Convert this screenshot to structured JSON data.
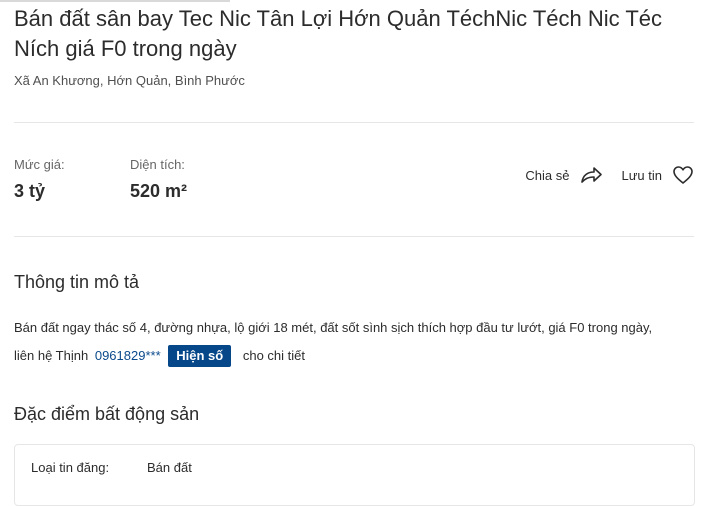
{
  "listing": {
    "title": "Bán đất sân bay Tec Nic Tân Lợi Hớn Quản TéchNic Téch Nic Téc Ních giá F0 trong ngày",
    "address": "Xã An Khương, Hớn Quản, Bình Phước"
  },
  "stats": {
    "price_label": "Mức giá:",
    "price_value": "3 tỷ",
    "area_label": "Diện tích:",
    "area_value": "520 m²"
  },
  "actions": {
    "share_label": "Chia sẻ",
    "share_icon": "share-arrow-icon",
    "save_label": "Lưu tin",
    "save_icon": "heart-icon"
  },
  "description": {
    "heading": "Thông tin mô tả",
    "text_line1": "Bán đất ngay thác số 4, đường nhựa, lộ giới 18 mét, đất sốt sình sịch thích hợp đầu tư lướt, giá F0 trong ngày,",
    "text_prefix": "liên hệ Thịnh",
    "phone_masked": "0961829***",
    "show_button": "Hiện số",
    "text_suffix": "cho chi tiết",
    "accent_color": "#06478a"
  },
  "features": {
    "heading": "Đặc điểm bất động sản",
    "rows": [
      {
        "key": "Loại tin đăng:",
        "value": "Bán đất"
      }
    ]
  }
}
